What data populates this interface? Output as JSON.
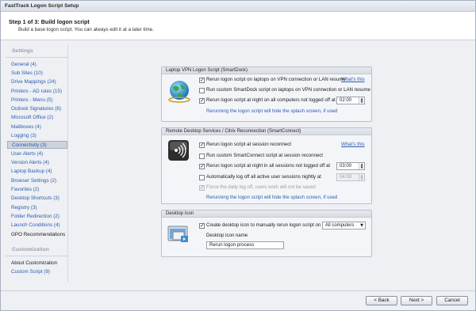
{
  "window": {
    "title": "FastTrack Logon Script Setup"
  },
  "header": {
    "step": "Step 1 of 3: Build logon script",
    "subtitle": "Build a base logon script. You can always edit it at a later time."
  },
  "sidebar": {
    "settings_title": "Settings",
    "items": [
      {
        "label": "General (4)"
      },
      {
        "label": "Sub Sites (10)"
      },
      {
        "label": "Drive Mappings (24)"
      },
      {
        "label": "Printers - AD rules (15)"
      },
      {
        "label": "Printers - Menu (5)"
      },
      {
        "label": "Outlook Signatures (8)"
      },
      {
        "label": "Microsoft Office (2)"
      },
      {
        "label": "Mailboxes (4)"
      },
      {
        "label": "Logging (3)"
      },
      {
        "label": "Connectivity (3)",
        "selected": true
      },
      {
        "label": "User Alerts (4)"
      },
      {
        "label": "Version Alerts (4)"
      },
      {
        "label": "Laptop Backup (4)"
      },
      {
        "label": "Browser Settings (2)"
      },
      {
        "label": "Favorites (2)"
      },
      {
        "label": "Desktop Shortcuts (3)"
      },
      {
        "label": "Registry (3)"
      },
      {
        "label": "Folder Redirection (2)"
      },
      {
        "label": "Launch Conditions (4)"
      },
      {
        "label": "GPO Recommendations"
      }
    ],
    "customization_title": "Customization",
    "custom_items": [
      {
        "label": "About Customization"
      },
      {
        "label": "Custom Script (9)"
      }
    ]
  },
  "vpn": {
    "title": "Laptop VPN Logon Script (SmartDock)",
    "opt1": "Rerun logon script on laptops on VPN connection or LAN resume",
    "whats_this": "What's this",
    "opt2": "Run custom SmartDock script on laptops on VPN connection or LAN resume",
    "opt3": "Rerun logon script at night on all computers not logged off at",
    "time": "02:00",
    "note": "Rerunning the logon script will hide the splash screen, if used"
  },
  "rds": {
    "title": "Remote Desktop Services / Citrix Reconnection (SmartConnect)",
    "opt1": "Rerun logon script at session reconnect",
    "whats_this": "What's this",
    "opt2": "Run custom SmartConnect script at session reconnect",
    "opt3": "Rerun logon script at night in all sessions not logged off at",
    "time1": "03:00",
    "opt4": "Automatically log off all active user sessions nightly at",
    "time2": "04:00",
    "opt5": "Force the daily log off, users work will not be saved",
    "note": "Rerunning the logon script will hide the splash screen, if used"
  },
  "desktop": {
    "title": "Desktop Icon",
    "opt1": "Create desktop icon to manually rerun logon script on",
    "select_value": "All computers",
    "name_label": "Desktop icon name",
    "name_value": "Rerun logon process"
  },
  "footer": {
    "back": "< Back",
    "next": "Next >",
    "cancel": "Cancel"
  }
}
